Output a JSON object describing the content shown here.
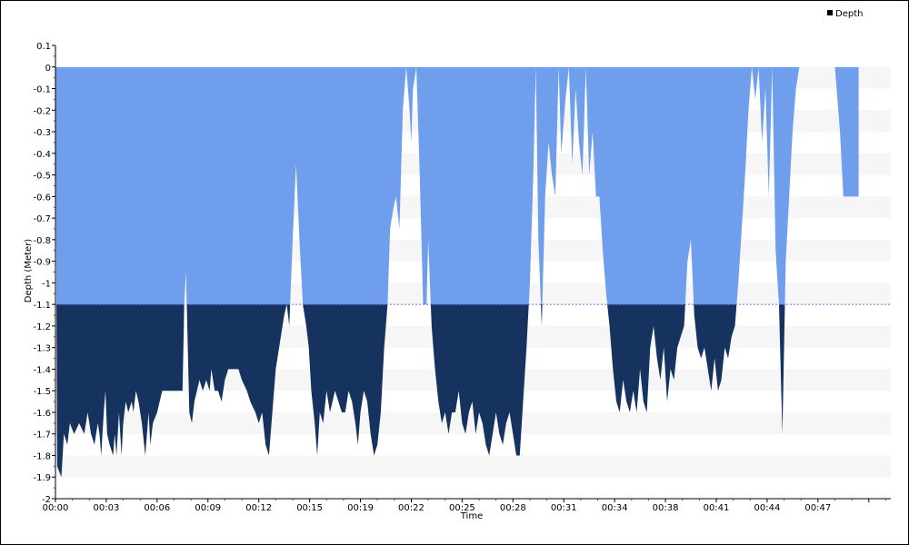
{
  "chart_data": {
    "type": "area",
    "xlabel": "Time",
    "ylabel": "Depth (Meter)",
    "legend": {
      "label": "Depth",
      "placement": "top-right",
      "color": "#000000"
    },
    "ylim": [
      -2,
      0.1
    ],
    "xlim_minutes": [
      0,
      49.3
    ],
    "threshold": -1.1,
    "y_ticks": [
      0.1,
      0,
      -0.1,
      -0.2,
      -0.3,
      -0.4,
      -0.5,
      -0.6,
      -0.7,
      -0.8,
      -0.9,
      -1,
      -1.1,
      -1.2,
      -1.3,
      -1.4,
      -1.5,
      -1.6,
      -1.7,
      -1.8,
      -1.9,
      -2
    ],
    "y_tick_labels": [
      "0.1",
      "0",
      "-0.1",
      "-0.2",
      "-0.3",
      "-0.4",
      "-0.5",
      "-0.6",
      "-0.7",
      "-0.8",
      "-0.9",
      "-1",
      "-1.1",
      "-1.2",
      "-1.3",
      "-1.4",
      "-1.5",
      "-1.6",
      "-1.7",
      "-1.8",
      "-1.9",
      "-2"
    ],
    "x_ticks_minutes": [
      0,
      3,
      6,
      9,
      12,
      15,
      18,
      21,
      24,
      27,
      30,
      33,
      36,
      39,
      42,
      45,
      48
    ],
    "x_tick_labels": [
      "00:00",
      "00:03",
      "00:06",
      "00:09",
      "00:12",
      "00:15",
      "00:19",
      "00:22",
      "00:25",
      "00:28",
      "00:31",
      "00:34",
      "00:38",
      "00:41",
      "00:44",
      "00:47"
    ],
    "colors": {
      "upper_fill": "#6e9eec",
      "lower_fill": "#16325f",
      "threshold_line": "#6b6bff",
      "band": "#f6f6f6"
    },
    "series": [
      {
        "name": "Depth",
        "points": [
          [
            0,
            0
          ],
          [
            0.1,
            -1.85
          ],
          [
            0.35,
            -1.9
          ],
          [
            0.5,
            -1.7
          ],
          [
            0.7,
            -1.75
          ],
          [
            0.85,
            -1.65
          ],
          [
            1.1,
            -1.7
          ],
          [
            1.4,
            -1.65
          ],
          [
            1.7,
            -1.7
          ],
          [
            1.9,
            -1.6
          ],
          [
            2.1,
            -1.7
          ],
          [
            2.3,
            -1.75
          ],
          [
            2.5,
            -1.65
          ],
          [
            2.6,
            -1.7
          ],
          [
            2.7,
            -1.8
          ],
          [
            2.85,
            -1.6
          ],
          [
            2.95,
            -1.5
          ],
          [
            3.05,
            -1.7
          ],
          [
            3.2,
            -1.75
          ],
          [
            3.4,
            -1.8
          ],
          [
            3.5,
            -1.7
          ],
          [
            3.6,
            -1.8
          ],
          [
            3.75,
            -1.6
          ],
          [
            3.9,
            -1.8
          ],
          [
            4,
            -1.65
          ],
          [
            4.15,
            -1.55
          ],
          [
            4.3,
            -1.6
          ],
          [
            4.5,
            -1.55
          ],
          [
            4.6,
            -1.6
          ],
          [
            4.75,
            -1.5
          ],
          [
            4.9,
            -1.55
          ],
          [
            5.1,
            -1.65
          ],
          [
            5.3,
            -1.8
          ],
          [
            5.5,
            -1.6
          ],
          [
            5.6,
            -1.75
          ],
          [
            5.75,
            -1.65
          ],
          [
            6,
            -1.6
          ],
          [
            6.15,
            -1.55
          ],
          [
            6.3,
            -1.5
          ],
          [
            6.5,
            -1.5
          ],
          [
            6.8,
            -1.5
          ],
          [
            7.1,
            -1.5
          ],
          [
            7.3,
            -1.5
          ],
          [
            7.5,
            -1.5
          ],
          [
            7.6,
            -1.1
          ],
          [
            7.7,
            -0.95
          ],
          [
            7.75,
            -1.1
          ],
          [
            7.9,
            -1.6
          ],
          [
            8.05,
            -1.65
          ],
          [
            8.2,
            -1.55
          ],
          [
            8.35,
            -1.5
          ],
          [
            8.5,
            -1.45
          ],
          [
            8.7,
            -1.5
          ],
          [
            8.9,
            -1.45
          ],
          [
            9.1,
            -1.5
          ],
          [
            9.2,
            -1.4
          ],
          [
            9.4,
            -1.5
          ],
          [
            9.6,
            -1.5
          ],
          [
            9.8,
            -1.55
          ],
          [
            10,
            -1.45
          ],
          [
            10.2,
            -1.4
          ],
          [
            10.5,
            -1.4
          ],
          [
            10.8,
            -1.4
          ],
          [
            11,
            -1.45
          ],
          [
            11.3,
            -1.5
          ],
          [
            11.5,
            -1.55
          ],
          [
            11.8,
            -1.6
          ],
          [
            12,
            -1.65
          ],
          [
            12.2,
            -1.6
          ],
          [
            12.4,
            -1.75
          ],
          [
            12.6,
            -1.8
          ],
          [
            12.8,
            -1.6
          ],
          [
            13,
            -1.4
          ],
          [
            13.2,
            -1.3
          ],
          [
            13.4,
            -1.2
          ],
          [
            13.5,
            -1.15
          ],
          [
            13.65,
            -1.1
          ],
          [
            13.8,
            -1.2
          ],
          [
            14.0,
            -0.8
          ],
          [
            14.2,
            -0.45
          ],
          [
            14.4,
            -0.8
          ],
          [
            14.6,
            -1.1
          ],
          [
            14.8,
            -1.2
          ],
          [
            14.95,
            -1.3
          ],
          [
            15.1,
            -1.5
          ],
          [
            15.3,
            -1.65
          ],
          [
            15.45,
            -1.8
          ],
          [
            15.6,
            -1.6
          ],
          [
            15.8,
            -1.65
          ],
          [
            16.0,
            -1.5
          ],
          [
            16.2,
            -1.6
          ],
          [
            16.5,
            -1.5
          ],
          [
            16.7,
            -1.55
          ],
          [
            16.9,
            -1.6
          ],
          [
            17.1,
            -1.6
          ],
          [
            17.3,
            -1.5
          ],
          [
            17.5,
            -1.55
          ],
          [
            17.7,
            -1.65
          ],
          [
            17.85,
            -1.75
          ],
          [
            18.0,
            -1.6
          ],
          [
            18.2,
            -1.5
          ],
          [
            18.4,
            -1.55
          ],
          [
            18.6,
            -1.7
          ],
          [
            18.8,
            -1.8
          ],
          [
            19.0,
            -1.75
          ],
          [
            19.2,
            -1.6
          ],
          [
            19.4,
            -1.3
          ],
          [
            19.6,
            -1.1
          ],
          [
            19.75,
            -0.75
          ],
          [
            19.95,
            -0.65
          ],
          [
            20.1,
            -0.6
          ],
          [
            20.3,
            -0.75
          ],
          [
            20.5,
            -0.2
          ],
          [
            20.7,
            0
          ],
          [
            20.9,
            -0.2
          ],
          [
            21.0,
            -0.35
          ],
          [
            21.1,
            -0.1
          ],
          [
            21.3,
            0
          ],
          [
            21.5,
            -0.5
          ],
          [
            21.7,
            -1.1
          ],
          [
            21.9,
            -1.1
          ],
          [
            22.0,
            -0.8
          ],
          [
            22.2,
            -1.2
          ],
          [
            22.4,
            -1.4
          ],
          [
            22.6,
            -1.55
          ],
          [
            22.8,
            -1.65
          ],
          [
            23.0,
            -1.6
          ],
          [
            23.2,
            -1.7
          ],
          [
            23.4,
            -1.6
          ],
          [
            23.6,
            -1.6
          ],
          [
            23.8,
            -1.5
          ],
          [
            24.0,
            -1.65
          ],
          [
            24.2,
            -1.7
          ],
          [
            24.4,
            -1.6
          ],
          [
            24.6,
            -1.55
          ],
          [
            24.8,
            -1.7
          ],
          [
            25.0,
            -1.6
          ],
          [
            25.2,
            -1.65
          ],
          [
            25.4,
            -1.75
          ],
          [
            25.6,
            -1.8
          ],
          [
            25.8,
            -1.7
          ],
          [
            26.0,
            -1.6
          ],
          [
            26.2,
            -1.7
          ],
          [
            26.4,
            -1.75
          ],
          [
            26.6,
            -1.65
          ],
          [
            26.8,
            -1.6
          ],
          [
            27.0,
            -1.7
          ],
          [
            27.2,
            -1.8
          ],
          [
            27.4,
            -1.8
          ],
          [
            27.6,
            -1.55
          ],
          [
            27.8,
            -1.3
          ],
          [
            28.0,
            -1.0
          ],
          [
            28.2,
            -0.5
          ],
          [
            28.35,
            0
          ],
          [
            28.5,
            -0.8
          ],
          [
            28.7,
            -1.2
          ],
          [
            28.9,
            -0.6
          ],
          [
            29.1,
            -0.35
          ],
          [
            29.3,
            -0.5
          ],
          [
            29.5,
            -0.6
          ],
          [
            29.7,
            0
          ],
          [
            29.85,
            -0.4
          ],
          [
            30.1,
            -0.15
          ],
          [
            30.3,
            0
          ],
          [
            30.5,
            -0.45
          ],
          [
            30.7,
            -0.1
          ],
          [
            30.9,
            -0.35
          ],
          [
            31.1,
            -0.5
          ],
          [
            31.3,
            0
          ],
          [
            31.5,
            -0.5
          ],
          [
            31.7,
            -0.3
          ],
          [
            31.9,
            -0.6
          ],
          [
            32.1,
            -0.6
          ],
          [
            32.3,
            -0.85
          ],
          [
            32.5,
            -1.05
          ],
          [
            32.7,
            -1.2
          ],
          [
            32.9,
            -1.4
          ],
          [
            33.1,
            -1.55
          ],
          [
            33.3,
            -1.6
          ],
          [
            33.5,
            -1.45
          ],
          [
            33.7,
            -1.55
          ],
          [
            33.9,
            -1.6
          ],
          [
            34.1,
            -1.5
          ],
          [
            34.3,
            -1.6
          ],
          [
            34.5,
            -1.4
          ],
          [
            34.7,
            -1.55
          ],
          [
            34.9,
            -1.6
          ],
          [
            35.1,
            -1.3
          ],
          [
            35.3,
            -1.2
          ],
          [
            35.5,
            -1.35
          ],
          [
            35.7,
            -1.45
          ],
          [
            35.9,
            -1.3
          ],
          [
            36.1,
            -1.55
          ],
          [
            36.3,
            -1.4
          ],
          [
            36.5,
            -1.45
          ],
          [
            36.7,
            -1.3
          ],
          [
            36.9,
            -1.25
          ],
          [
            37.1,
            -1.2
          ],
          [
            37.3,
            -0.9
          ],
          [
            37.5,
            -0.8
          ],
          [
            37.7,
            -1.15
          ],
          [
            37.9,
            -1.3
          ],
          [
            38.1,
            -1.35
          ],
          [
            38.3,
            -1.3
          ],
          [
            38.5,
            -1.4
          ],
          [
            38.7,
            -1.5
          ],
          [
            38.9,
            -1.35
          ],
          [
            39.1,
            -1.5
          ],
          [
            39.3,
            -1.45
          ],
          [
            39.5,
            -1.3
          ],
          [
            39.7,
            -1.35
          ],
          [
            39.9,
            -1.25
          ],
          [
            40.1,
            -1.2
          ],
          [
            40.3,
            -1.0
          ],
          [
            40.5,
            -0.75
          ],
          [
            40.7,
            -0.5
          ],
          [
            40.9,
            -0.2
          ],
          [
            41.1,
            0
          ],
          [
            41.3,
            -0.15
          ],
          [
            41.5,
            0
          ],
          [
            41.7,
            -0.35
          ],
          [
            41.9,
            -0.1
          ],
          [
            42.1,
            -0.6
          ],
          [
            42.3,
            0
          ],
          [
            42.5,
            -0.85
          ],
          [
            42.7,
            -1.1
          ],
          [
            42.9,
            -1.7
          ],
          [
            43.1,
            -0.9
          ],
          [
            43.3,
            -0.6
          ],
          [
            43.5,
            -0.3
          ],
          [
            43.7,
            -0.1
          ],
          [
            43.9,
            0
          ],
          [
            44.2,
            0
          ],
          [
            44.6,
            0
          ],
          [
            45.0,
            0
          ],
          [
            45.4,
            0
          ],
          [
            45.7,
            0
          ],
          [
            46.0,
            0
          ],
          [
            46.3,
            -0.3
          ],
          [
            46.5,
            -0.6
          ],
          [
            46.8,
            -0.6
          ],
          [
            47.1,
            -0.6
          ],
          [
            47.4,
            -0.6
          ]
        ]
      }
    ]
  }
}
